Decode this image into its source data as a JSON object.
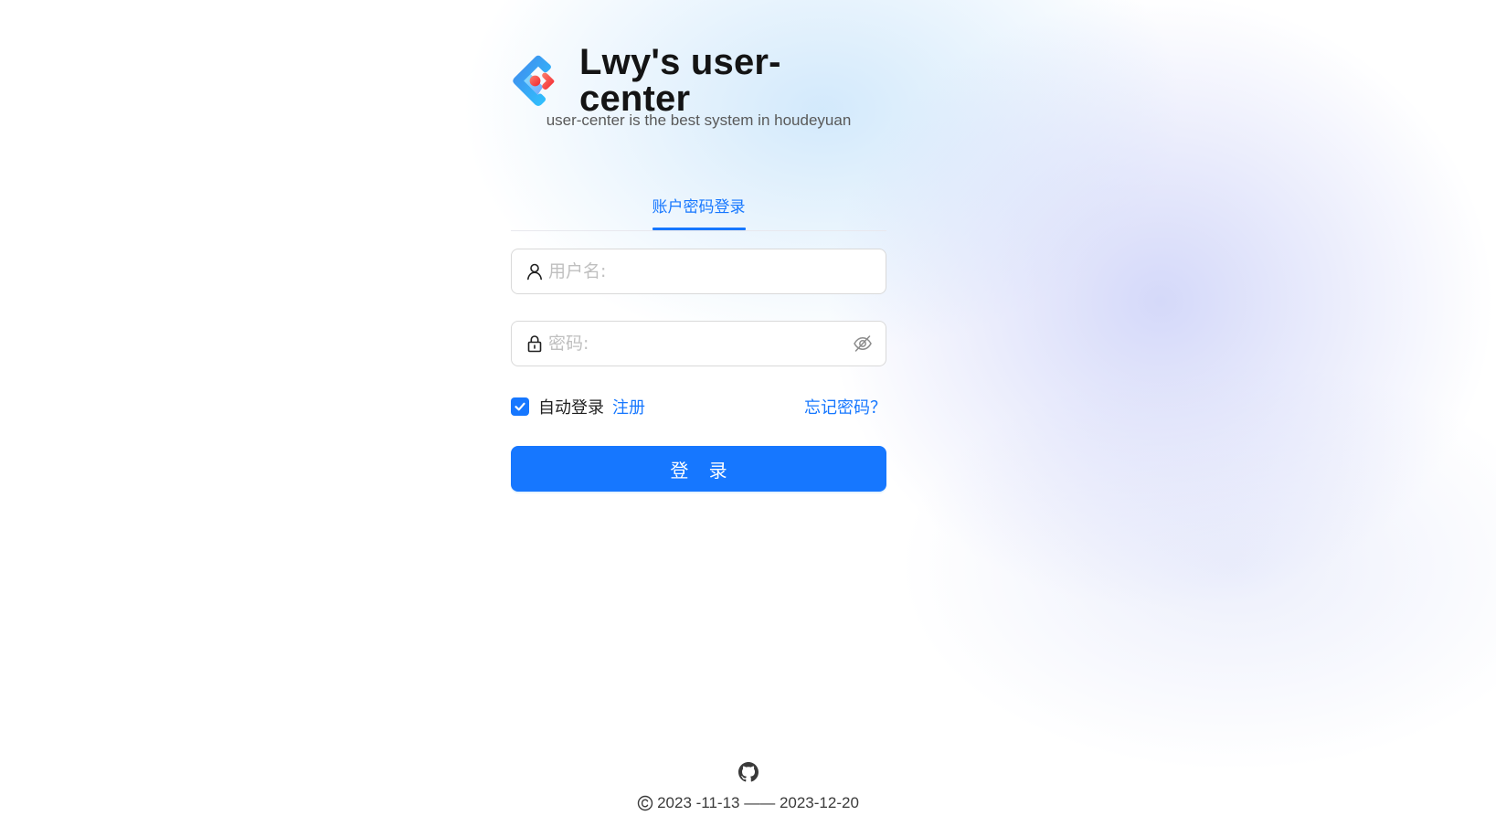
{
  "brand": {
    "title": "Lwy's user-center",
    "subtitle": "user-center is the best system in houdeyuan",
    "logo_icon": "ant-design-logo"
  },
  "tabs": [
    {
      "label": "账户密码登录",
      "active": true
    }
  ],
  "form": {
    "username": {
      "value": "",
      "placeholder": "用户名:",
      "icon": "user-icon"
    },
    "password": {
      "value": "",
      "placeholder": "密码:",
      "icon": "lock-icon",
      "toggle_icon": "eye-invisible-icon"
    },
    "auto_login": {
      "label": "自动登录",
      "checked": true
    },
    "register_link": "注册",
    "forgot_link": "忘记密码？",
    "submit_label": "登 录"
  },
  "footer": {
    "github_icon": "github-icon",
    "copyright_text": "2023 -11-13 —— 2023-12-20"
  },
  "colors": {
    "primary": "#1677ff",
    "text": "#1f1f1f",
    "placeholder": "#bfbfbf",
    "border": "#d9d9d9"
  }
}
